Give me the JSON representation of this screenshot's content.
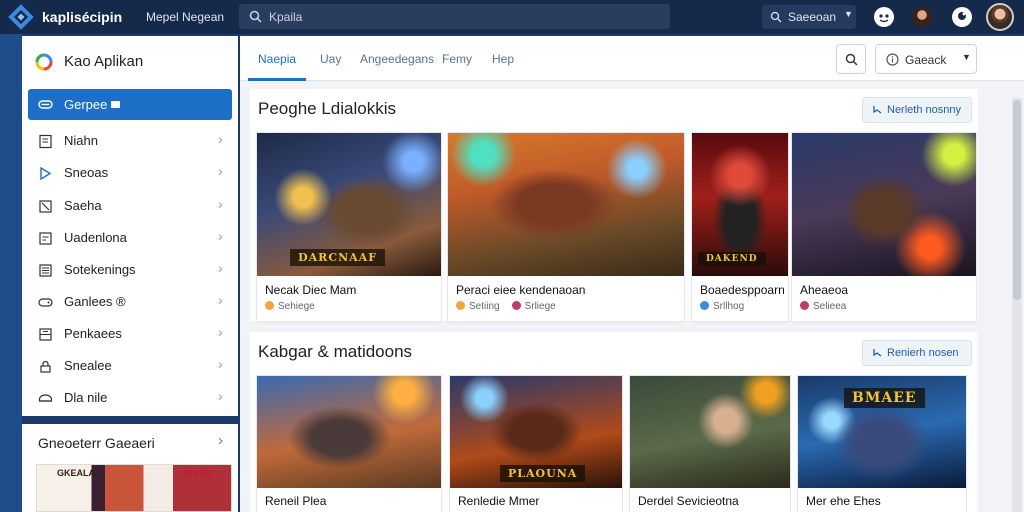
{
  "topbar": {
    "brand": "kaplisécipin",
    "link": "Mepel Negean",
    "search_value": "Kpaila",
    "account_label": "Saeeoan"
  },
  "sidebar": {
    "title": "Kao Aplikan",
    "active_item": {
      "label": "Gerpee",
      "icon": "gamepad-icon"
    },
    "items": [
      {
        "label": "Niahn",
        "icon": "document-icon"
      },
      {
        "label": "Sneoas",
        "icon": "play-icon"
      },
      {
        "label": "Saeha",
        "icon": "edit-icon"
      },
      {
        "label": "Uadenlona",
        "icon": "list-icon"
      },
      {
        "label": "Sotekenings",
        "icon": "doc-lines-icon"
      },
      {
        "label": "Ganlees ®",
        "icon": "controller-icon"
      },
      {
        "label": "Penkaees",
        "icon": "grid-icon"
      },
      {
        "label": "Snealee",
        "icon": "lock-icon"
      },
      {
        "label": "Dla nile",
        "icon": "car-icon"
      }
    ]
  },
  "sidebar_section": {
    "title": "Gneoeterr Gaeaeri",
    "thumb_text_1": "GKEALA",
    "thumb_text_2": "RVSS"
  },
  "tabs": [
    "Naepia",
    "Uay",
    "Angeedegans",
    "Femy",
    "Hep"
  ],
  "active_tab": 0,
  "filter": {
    "label": "Gaeack"
  },
  "sections": [
    {
      "title": "Peoghe Ldialokkis",
      "button": "Nerleth nosnny",
      "cards": [
        {
          "title": "Necak Diec Mam",
          "meta1": "Sehiege",
          "meta2": "",
          "banner": "DARCNAAF"
        },
        {
          "title": "Peraci eiee kendenaoan",
          "meta1": "Setiing",
          "meta2": "Srliege",
          "banner": ""
        },
        {
          "title": "Boaedesppoarn",
          "meta1": "Srllhog",
          "meta2": "",
          "banner": "DAKEND"
        },
        {
          "title": "Aheaeoa",
          "meta1": "Selieea",
          "meta2": "",
          "banner": ""
        }
      ]
    },
    {
      "title": "Kabgar & matidoons",
      "button": "Renierh nosen",
      "cards": [
        {
          "title": "Reneil Plea",
          "meta1": "",
          "meta2": "",
          "banner": ""
        },
        {
          "title": "Renledie Mmer",
          "meta1": "",
          "meta2": "",
          "banner": "PLAOUNA"
        },
        {
          "title": "Derdel Sevicieotna",
          "meta1": "",
          "meta2": "",
          "banner": ""
        },
        {
          "title": "Mer ehe Ehes",
          "meta1": "",
          "meta2": "",
          "banner": "BMAEE"
        }
      ]
    }
  ],
  "colors": {
    "accent": "#1e6fc8",
    "topbar": "#15294a",
    "strip": "#1e4d8a"
  }
}
